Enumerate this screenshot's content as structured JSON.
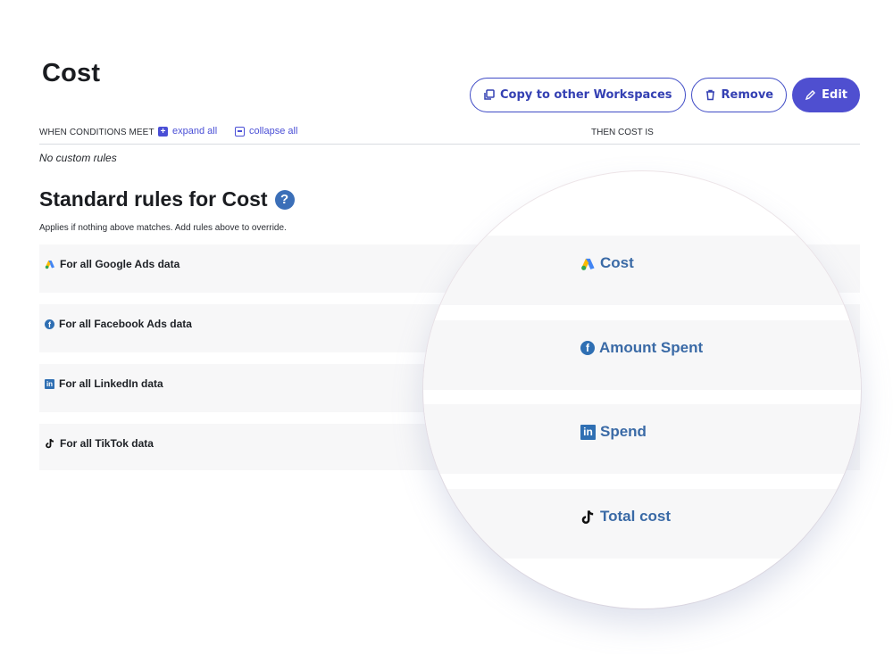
{
  "page": {
    "title": "Cost"
  },
  "actions": {
    "copy_label": "Copy to other Workspaces",
    "remove_label": "Remove",
    "edit_label": "Edit"
  },
  "conditions": {
    "when_label": "WHEN CONDITIONS MEET",
    "expand_label": "expand all",
    "collapse_label": "collapse all",
    "then_label": "THEN COST IS",
    "empty_text": "No custom rules"
  },
  "standard": {
    "title": "Standard rules for Cost",
    "subtitle": "Applies if nothing above matches. Add rules above to override.",
    "rules": [
      {
        "label": "For all Google Ads data",
        "icon": "google-ads-icon",
        "value": "Cost"
      },
      {
        "label": "For all Facebook Ads data",
        "icon": "facebook-icon",
        "value": "Amount Spent"
      },
      {
        "label": "For all LinkedIn data",
        "icon": "linkedin-icon",
        "value": "Spend"
      },
      {
        "label": "For all TikTok data",
        "icon": "tiktok-icon",
        "value": "Total cost"
      }
    ]
  },
  "colors": {
    "accent": "#4f4fd0",
    "link": "#4a4fd6",
    "value_text": "#3a6aa6"
  }
}
